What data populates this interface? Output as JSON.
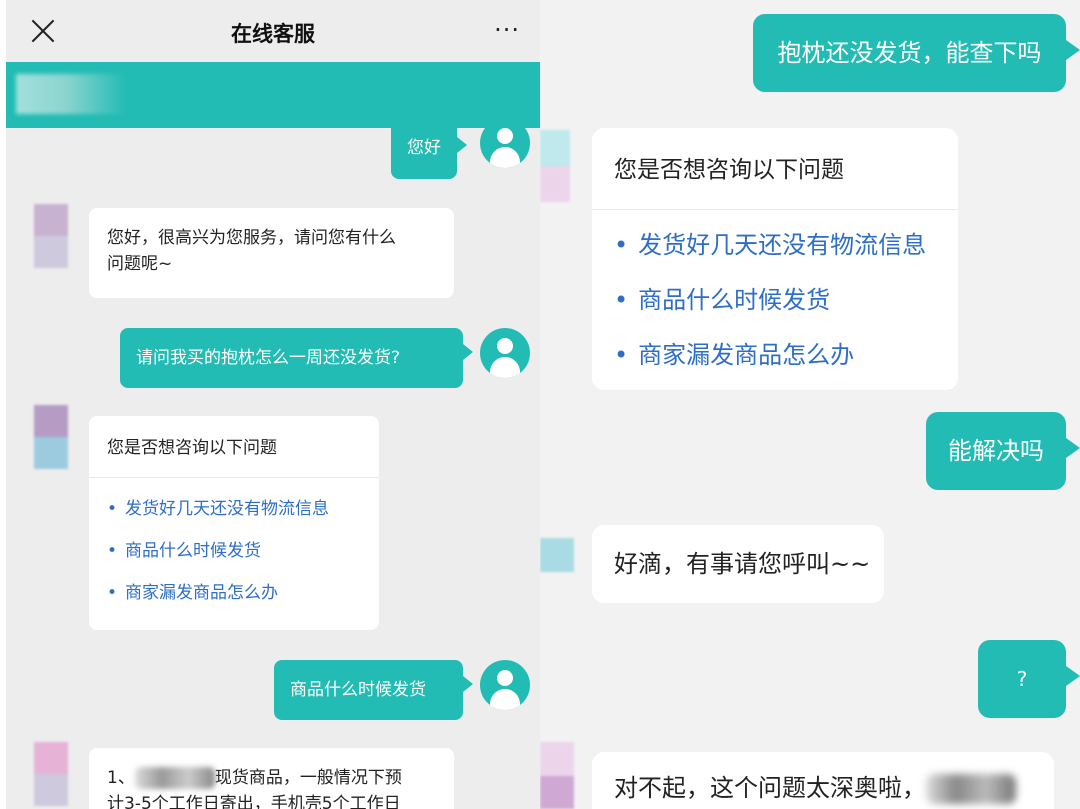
{
  "left": {
    "header": {
      "title": "在线客服",
      "more": "···"
    },
    "messages": [
      {
        "from": "user",
        "text": "您好"
      },
      {
        "from": "agent",
        "text_line1": "您好，很高兴为您服务，请问您有什么",
        "text_line2": "问题呢~"
      },
      {
        "from": "user",
        "text": "请问我买的抱枕怎么一周还没发货?"
      },
      {
        "from": "agent",
        "title": "您是否想咨询以下问题",
        "options": [
          "发货好几天还没有物流信息",
          "商品什么时候发货",
          "商家漏发商品怎么办"
        ]
      },
      {
        "from": "user",
        "text": "商品什么时候发货"
      },
      {
        "from": "agent",
        "prefix": "1、",
        "text_line1_rest": "现货商品，一般情况下预",
        "text_line2": "计3-5个工作日寄出，手机壳5个工作日"
      }
    ]
  },
  "right": {
    "messages": [
      {
        "from": "user",
        "text": "抱枕还没发货，能查下吗"
      },
      {
        "from": "agent",
        "title": "您是否想咨询以下问题",
        "options": [
          "发货好几天还没有物流信息",
          "商品什么时候发货",
          "商家漏发商品怎么办"
        ]
      },
      {
        "from": "user",
        "text": "能解决吗"
      },
      {
        "from": "agent",
        "text": "好滴，有事请您呼叫~~"
      },
      {
        "from": "user",
        "text": "?"
      },
      {
        "from": "agent",
        "text": "对不起，这个问题太深奥啦，"
      }
    ]
  },
  "colors": {
    "accent": "#22bcb4",
    "link": "#2d6ec9",
    "background_left": "#ededed",
    "background_right": "#f2f2f2"
  }
}
